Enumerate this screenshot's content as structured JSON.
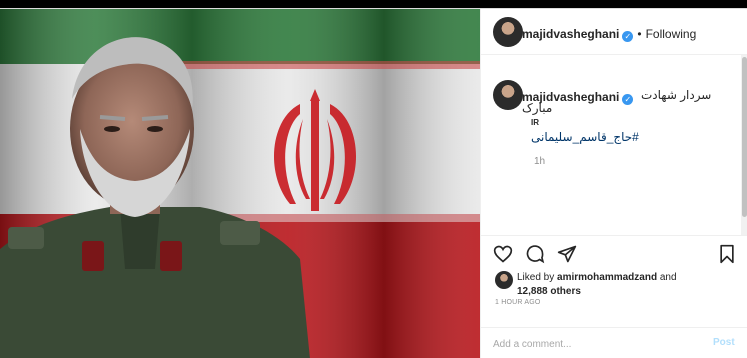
{
  "post": {
    "author": "majidvasheghani",
    "separator": "•",
    "follow_status": "Following",
    "verified_icon": "verified-check-icon",
    "caption": {
      "line1": "سردار شهادت",
      "line2": "مبارک",
      "line3": "IR",
      "hashtag": "#حاج_قاسم_سلیمانی",
      "time": "1h"
    },
    "likes": {
      "prefix": "Liked by ",
      "user": "amirmohammadzand",
      "and": " and",
      "others": "12,888 others"
    },
    "timestamp": "1 HOUR AGO",
    "comment_placeholder": "Add a comment...",
    "post_label": "Post"
  },
  "icons": [
    "heart-icon",
    "comment-icon",
    "share-icon",
    "bookmark-icon"
  ],
  "colors": {
    "link_blue": "#003569",
    "verified_blue": "#3897f0",
    "post_button_disabled": "#b2dffc",
    "flag_green": "#239f40",
    "flag_red": "#da0000"
  }
}
